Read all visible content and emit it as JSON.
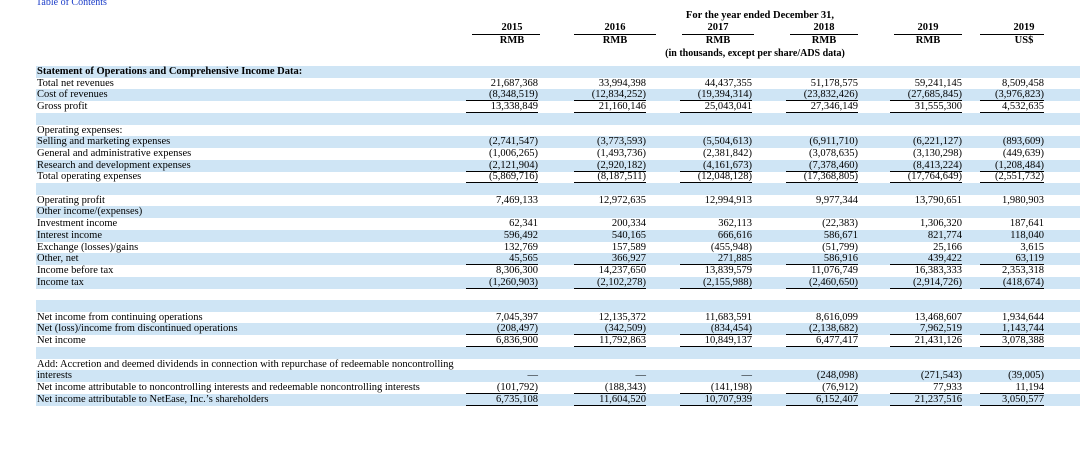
{
  "toc_link": "Table of Contents",
  "header": {
    "period": "For the year ended December 31,",
    "years": [
      "2015",
      "2016",
      "2017",
      "2018",
      "2019",
      "2019"
    ],
    "currencies": [
      "RMB",
      "RMB",
      "RMB",
      "RMB",
      "RMB",
      "US$"
    ],
    "note": "(in thousands, except per share/ADS data)"
  },
  "rows": [
    {
      "label": "Statement of Operations and Comprehensive Income Data:",
      "bold": true,
      "shaded": true,
      "values": [
        "",
        "",
        "",
        "",
        "",
        ""
      ]
    },
    {
      "label": "Total net revenues",
      "shaded": false,
      "values": [
        "21,687,368",
        "33,994,398",
        "44,437,355",
        "51,178,575",
        "59,241,145",
        "8,509,458"
      ]
    },
    {
      "label": "Cost of revenues",
      "shaded": true,
      "underline": true,
      "values": [
        "(8,348,519)",
        "(12,834,252)",
        "(19,394,314)",
        "(23,832,426)",
        "(27,685,845)",
        "(3,976,823)"
      ]
    },
    {
      "label": "Gross profit",
      "shaded": false,
      "underline": true,
      "values": [
        "13,338,849",
        "21,160,146",
        "25,043,041",
        "27,346,149",
        "31,555,300",
        "4,532,635"
      ]
    },
    {
      "label": "",
      "shaded": true,
      "values": [
        "",
        "",
        "",
        "",
        "",
        ""
      ]
    },
    {
      "label": "Operating expenses:",
      "shaded": false,
      "values": [
        "",
        "",
        "",
        "",
        "",
        ""
      ]
    },
    {
      "label": "Selling and marketing expenses",
      "shaded": true,
      "values": [
        "(2,741,547)",
        "(3,773,593)",
        "(5,504,613)",
        "(6,911,710)",
        "(6,221,127)",
        "(893,609)"
      ]
    },
    {
      "label": "General and administrative expenses",
      "shaded": false,
      "values": [
        "(1,006,265)",
        "(1,493,736)",
        "(2,381,842)",
        "(3,078,635)",
        "(3,130,298)",
        "(449,639)"
      ]
    },
    {
      "label": "Research and development expenses",
      "shaded": true,
      "underline": true,
      "values": [
        "(2,121,904)",
        "(2,920,182)",
        "(4,161,673)",
        "(7,378,460)",
        "(8,413,224)",
        "(1,208,484)"
      ]
    },
    {
      "label": "Total operating expenses",
      "shaded": false,
      "underline": true,
      "values": [
        "(5,869,716)",
        "(8,187,511)",
        "(12,048,128)",
        "(17,368,805)",
        "(17,764,649)",
        "(2,551,732)"
      ]
    },
    {
      "label": "",
      "shaded": true,
      "values": [
        "",
        "",
        "",
        "",
        "",
        ""
      ]
    },
    {
      "label": "Operating profit",
      "shaded": false,
      "values": [
        "7,469,133",
        "12,972,635",
        "12,994,913",
        "9,977,344",
        "13,790,651",
        "1,980,903"
      ]
    },
    {
      "label": "Other income/(expenses)",
      "shaded": true,
      "values": [
        "",
        "",
        "",
        "",
        "",
        ""
      ]
    },
    {
      "label": "Investment income",
      "shaded": false,
      "values": [
        "62,341",
        "200,334",
        "362,113",
        "(22,383)",
        "1,306,320",
        "187,641"
      ]
    },
    {
      "label": "Interest income",
      "shaded": true,
      "values": [
        "596,492",
        "540,165",
        "666,616",
        "586,671",
        "821,774",
        "118,040"
      ]
    },
    {
      "label": "Exchange (losses)/gains",
      "shaded": false,
      "values": [
        "132,769",
        "157,589",
        "(455,948)",
        "(51,799)",
        "25,166",
        "3,615"
      ]
    },
    {
      "label": "Other, net",
      "shaded": true,
      "underline": true,
      "values": [
        "45,565",
        "366,927",
        "271,885",
        "586,916",
        "439,422",
        "63,119"
      ]
    },
    {
      "label": "Income before tax",
      "shaded": false,
      "values": [
        "8,306,300",
        "14,237,650",
        "13,839,579",
        "11,076,749",
        "16,383,333",
        "2,353,318"
      ]
    },
    {
      "label": "Income tax",
      "shaded": true,
      "underline": true,
      "values": [
        "(1,260,903)",
        "(2,102,278)",
        "(2,155,988)",
        "(2,460,650)",
        "(2,914,726)",
        "(418,674)"
      ]
    },
    {
      "label": "",
      "shaded": false,
      "values": [
        "",
        "",
        "",
        "",
        "",
        ""
      ]
    },
    {
      "label": "",
      "shaded": true,
      "values": [
        "",
        "",
        "",
        "",
        "",
        ""
      ]
    },
    {
      "label": "Net income from continuing operations",
      "shaded": false,
      "values": [
        "7,045,397",
        "12,135,372",
        "11,683,591",
        "8,616,099",
        "13,468,607",
        "1,934,644"
      ]
    },
    {
      "label": "Net (loss)/income from discontinued operations",
      "shaded": true,
      "underline": true,
      "values": [
        "(208,497)",
        "(342,509)",
        "(834,454)",
        "(2,138,682)",
        "7,962,519",
        "1,143,744"
      ]
    },
    {
      "label": "Net income",
      "shaded": false,
      "underline": true,
      "values": [
        "6,836,900",
        "11,792,863",
        "10,849,137",
        "6,477,417",
        "21,431,126",
        "3,078,388"
      ]
    },
    {
      "label": "",
      "shaded": true,
      "values": [
        "",
        "",
        "",
        "",
        "",
        ""
      ]
    },
    {
      "label": "Add: Accretion and deemed dividends in connection with repurchase of redeemable noncontrolling",
      "shaded": false,
      "values": [
        "",
        "",
        "",
        "",
        "",
        ""
      ]
    },
    {
      "label": "interests",
      "shaded": true,
      "values": [
        "—",
        "—",
        "—",
        "(248,098)",
        "(271,543)",
        "(39,005)"
      ]
    },
    {
      "label": "Net income attributable to noncontrolling interests and redeemable noncontrolling interests",
      "shaded": false,
      "underline": true,
      "values": [
        "(101,792)",
        "(188,343)",
        "(141,198)",
        "(76,912)",
        "77,933",
        "11,194"
      ]
    },
    {
      "label": "Net income attributable to NetEase, Inc.’s shareholders",
      "shaded": true,
      "underline": true,
      "values": [
        "6,735,108",
        "11,604,520",
        "10,707,939",
        "6,152,407",
        "21,237,516",
        "3,050,577"
      ]
    }
  ]
}
